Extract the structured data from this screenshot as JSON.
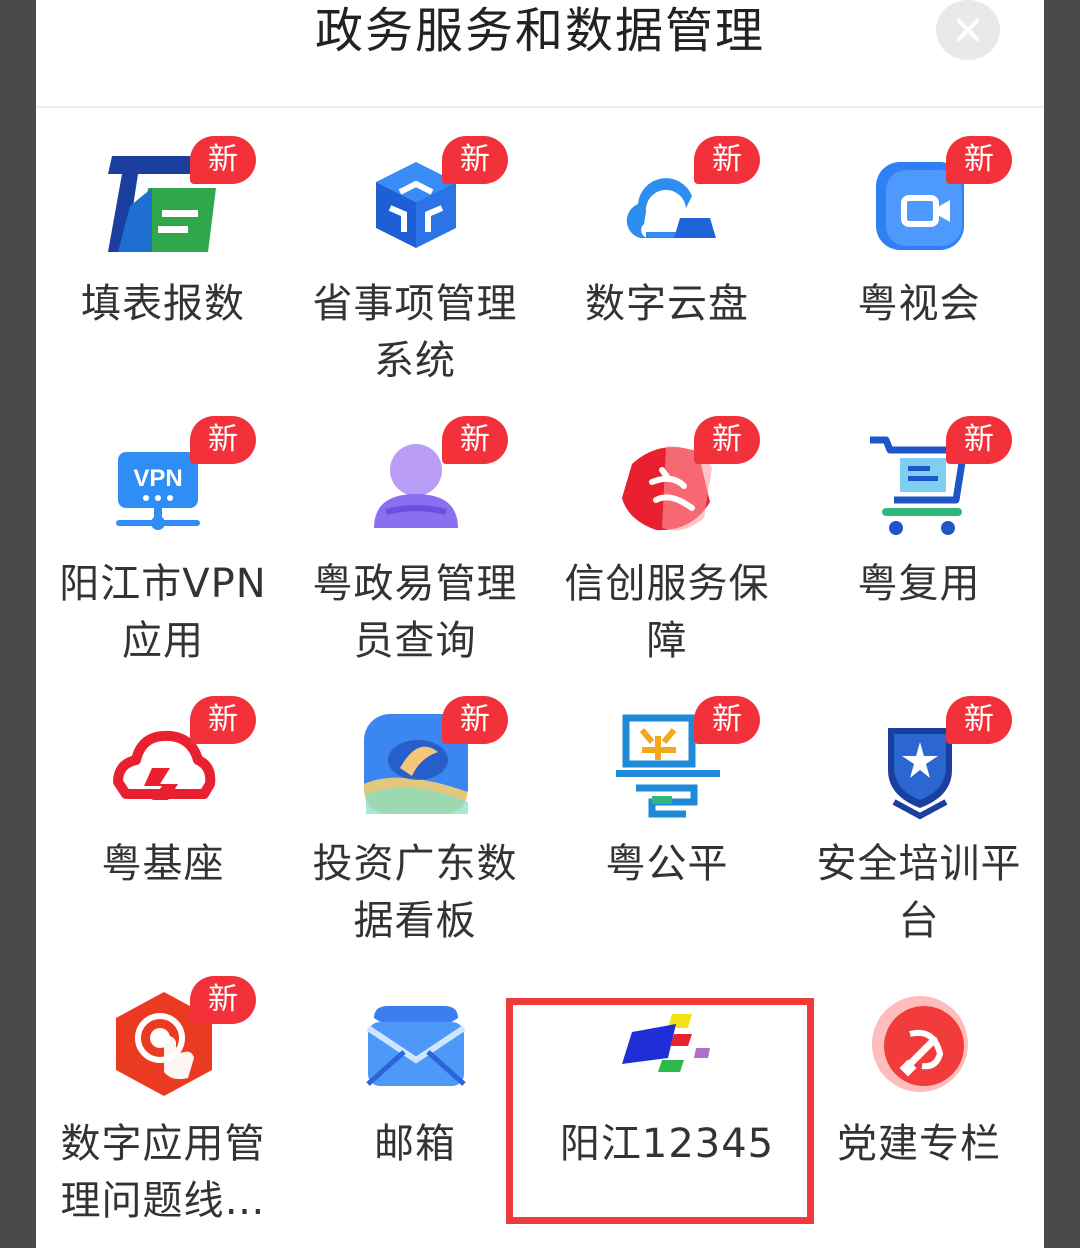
{
  "header": {
    "title": "政务服务和数据管理"
  },
  "badge_text": "新",
  "colors": {
    "badge": "#f2313a",
    "highlight": "#ee3a3a"
  },
  "apps": [
    {
      "label": "填表报数",
      "icon": "form-report-icon",
      "badge": true
    },
    {
      "label": "省事项管理系统",
      "icon": "matter-cube-icon",
      "badge": true
    },
    {
      "label": "数字云盘",
      "icon": "cloud-disk-icon",
      "badge": true
    },
    {
      "label": "粤视会",
      "icon": "video-meeting-icon",
      "badge": true
    },
    {
      "label": "阳江市VPN应用",
      "icon": "vpn-monitor-icon",
      "badge": true
    },
    {
      "label": "粤政易管理员查询",
      "icon": "admin-user-icon",
      "badge": true
    },
    {
      "label": "信创服务保障",
      "icon": "xinchuang-shield-icon",
      "badge": true
    },
    {
      "label": "粤复用",
      "icon": "shopping-cart-icon",
      "badge": true
    },
    {
      "label": "粤基座",
      "icon": "base-cloud-icon",
      "badge": true
    },
    {
      "label": "投资广东数据看板",
      "icon": "invest-dashboard-icon",
      "badge": true
    },
    {
      "label": "粤公平",
      "icon": "fairness-glyph-icon",
      "badge": true
    },
    {
      "label": "安全培训平台",
      "icon": "security-shield-icon",
      "badge": true
    },
    {
      "label": "数字应用管理问题线…",
      "icon": "touch-hotline-icon",
      "badge": true
    },
    {
      "label": "邮箱",
      "icon": "mail-envelope-icon",
      "badge": false
    },
    {
      "label": "阳江12345",
      "icon": "hotline-12345-logo-icon",
      "badge": false
    },
    {
      "label": "党建专栏",
      "icon": "party-emblem-icon",
      "badge": false
    }
  ]
}
